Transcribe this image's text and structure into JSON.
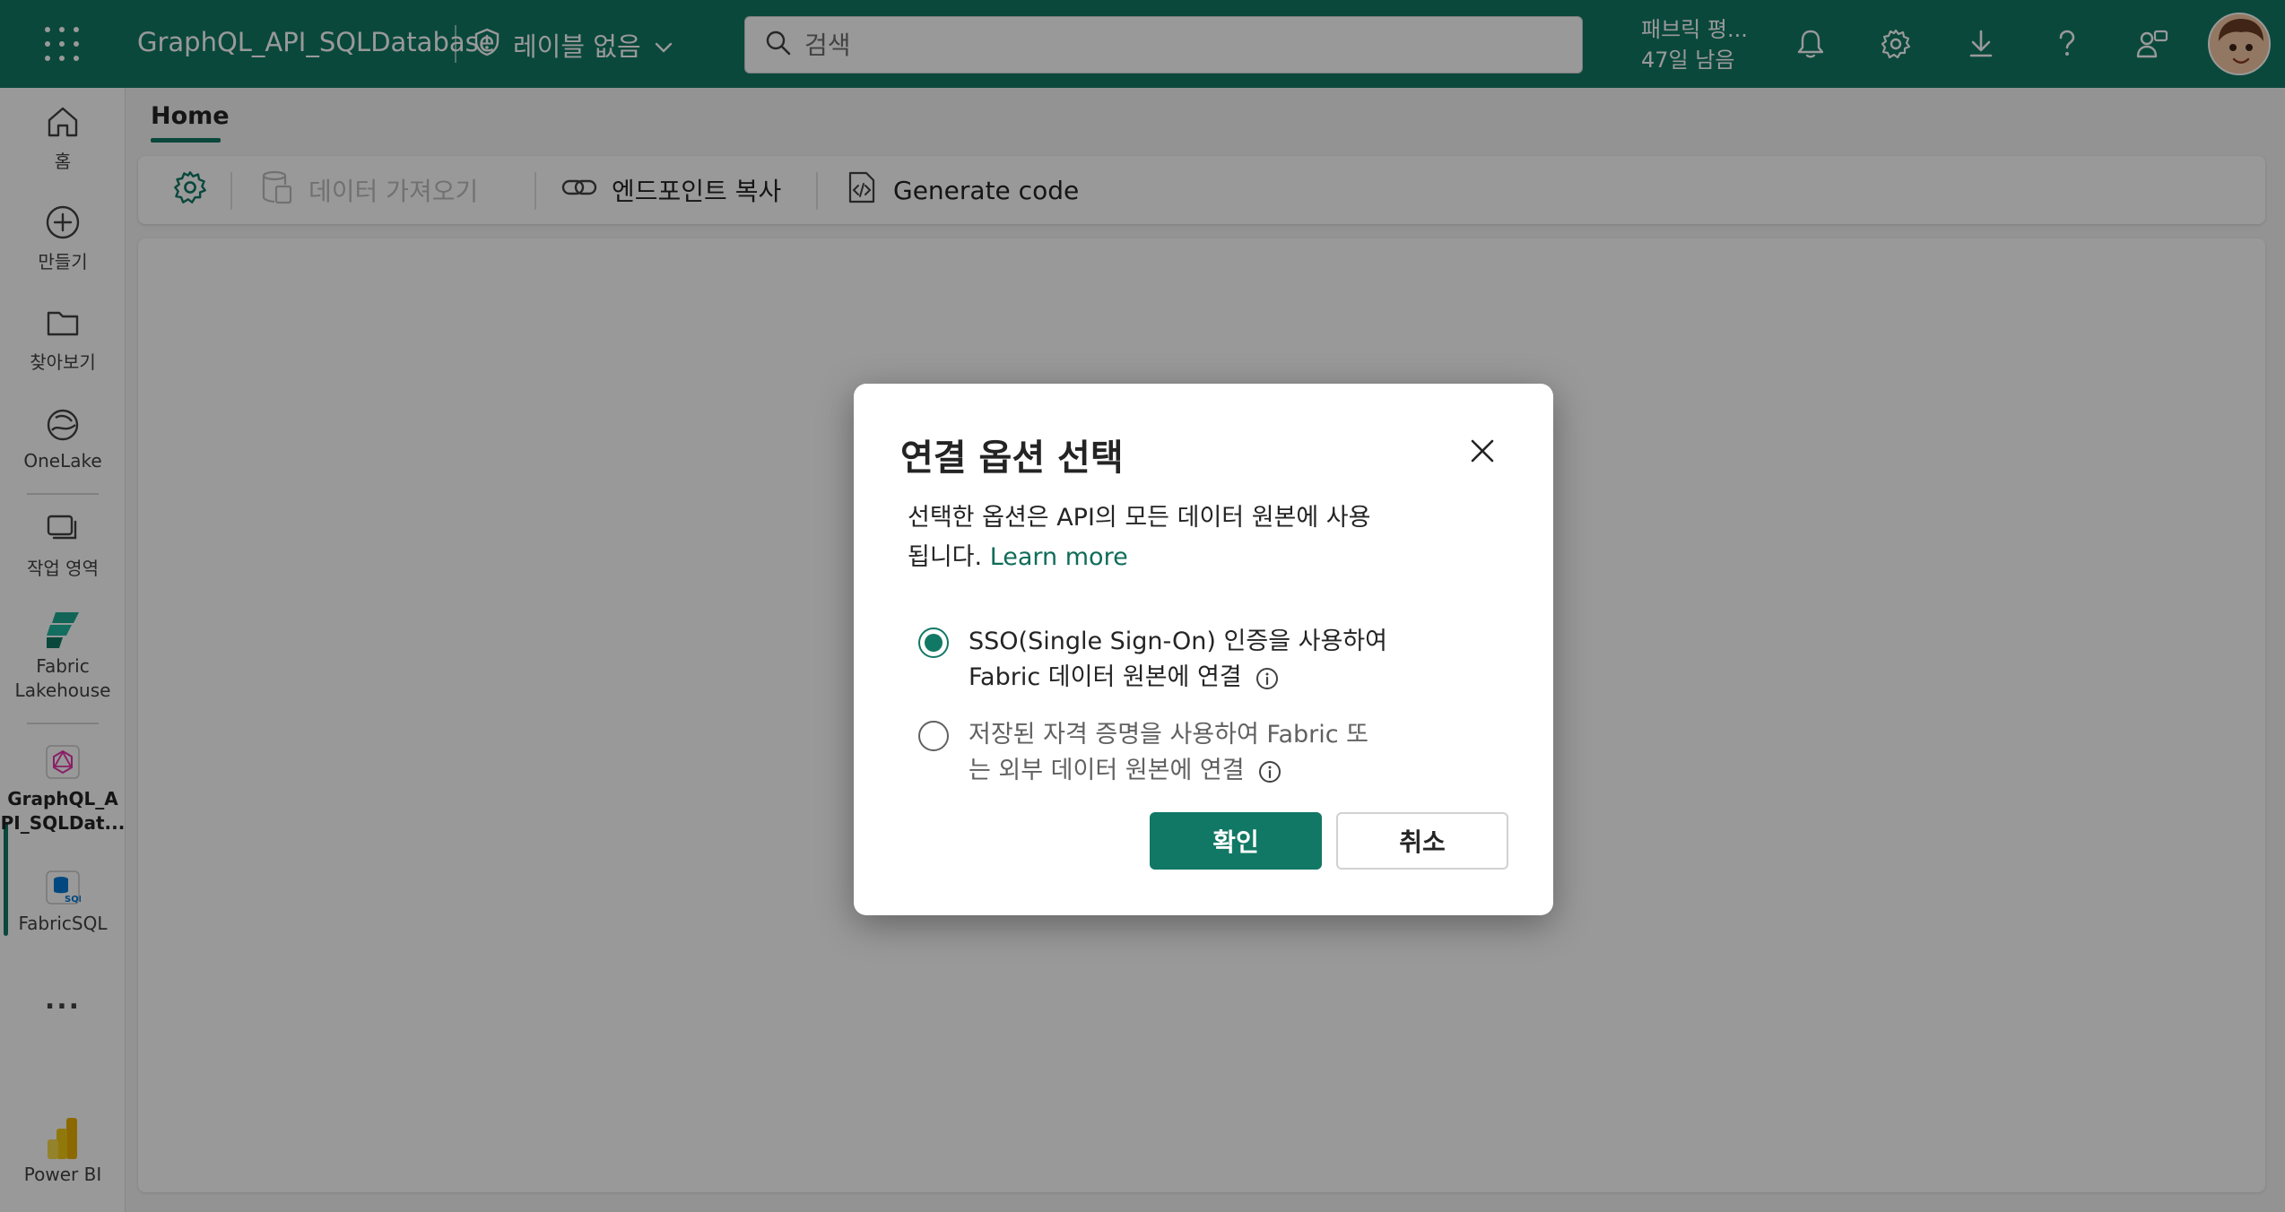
{
  "topbar": {
    "app_title": "GraphQL_API_SQLDatabase",
    "sensitivity_label": "레이블 없음",
    "search_placeholder": "검색",
    "trial_line1": "패브릭 평...",
    "trial_line2": "47일 남음",
    "icons": [
      "waffle-icon",
      "shield-icon",
      "chevron-down-icon",
      "search-icon",
      "bell-icon",
      "gear-icon",
      "download-icon",
      "help-icon",
      "share-feedback-icon",
      "avatar"
    ]
  },
  "rail": {
    "items": [
      {
        "label": "홈",
        "icon": "home-icon"
      },
      {
        "label": "만들기",
        "icon": "plus-circle-icon"
      },
      {
        "label": "찾아보기",
        "icon": "folder-icon"
      },
      {
        "label": "OneLake",
        "icon": "onelake-icon"
      },
      {
        "label": "작업 영역",
        "icon": "workspace-icon"
      },
      {
        "label": "Fabric Lakehouse",
        "label_line1": "Fabric",
        "label_line2": "Lakehouse",
        "icon": "lakehouse-icon"
      },
      {
        "label": "GraphQL_API_SQLDat...",
        "label_line1": "GraphQL_A",
        "label_line2": "PI_SQLDat...",
        "icon": "graphql-icon"
      },
      {
        "label": "FabricSQL",
        "icon": "sql-database-icon"
      },
      {
        "label": "...",
        "icon": "more-icon"
      },
      {
        "label": "Power BI",
        "icon": "powerbi-icon"
      }
    ]
  },
  "main": {
    "tab": "Home",
    "ribbon": {
      "get_data": "데이터 가져오기",
      "copy_endpoint": "엔드포인트 복사",
      "generate_code": "Generate code"
    }
  },
  "dialog": {
    "title": "연결 옵션 선택",
    "desc_line1": "선택한 옵션은 API의 모든 데이터 원본에 사용",
    "desc_line2": "됩니다.",
    "learn_more": "Learn more",
    "option1_line1": "SSO(Single Sign-On) 인증을 사용하여",
    "option1_line2": "Fabric 데이터 원본에 연결",
    "option2_line1": "저장된 자격 증명을 사용하여 Fabric 또",
    "option2_line2": "는 외부 데이터 원본에 연결",
    "selected_option": 1,
    "confirm": "확인",
    "cancel": "취소"
  },
  "colors": {
    "brand": "#117865",
    "link": "#0f6c5a"
  }
}
